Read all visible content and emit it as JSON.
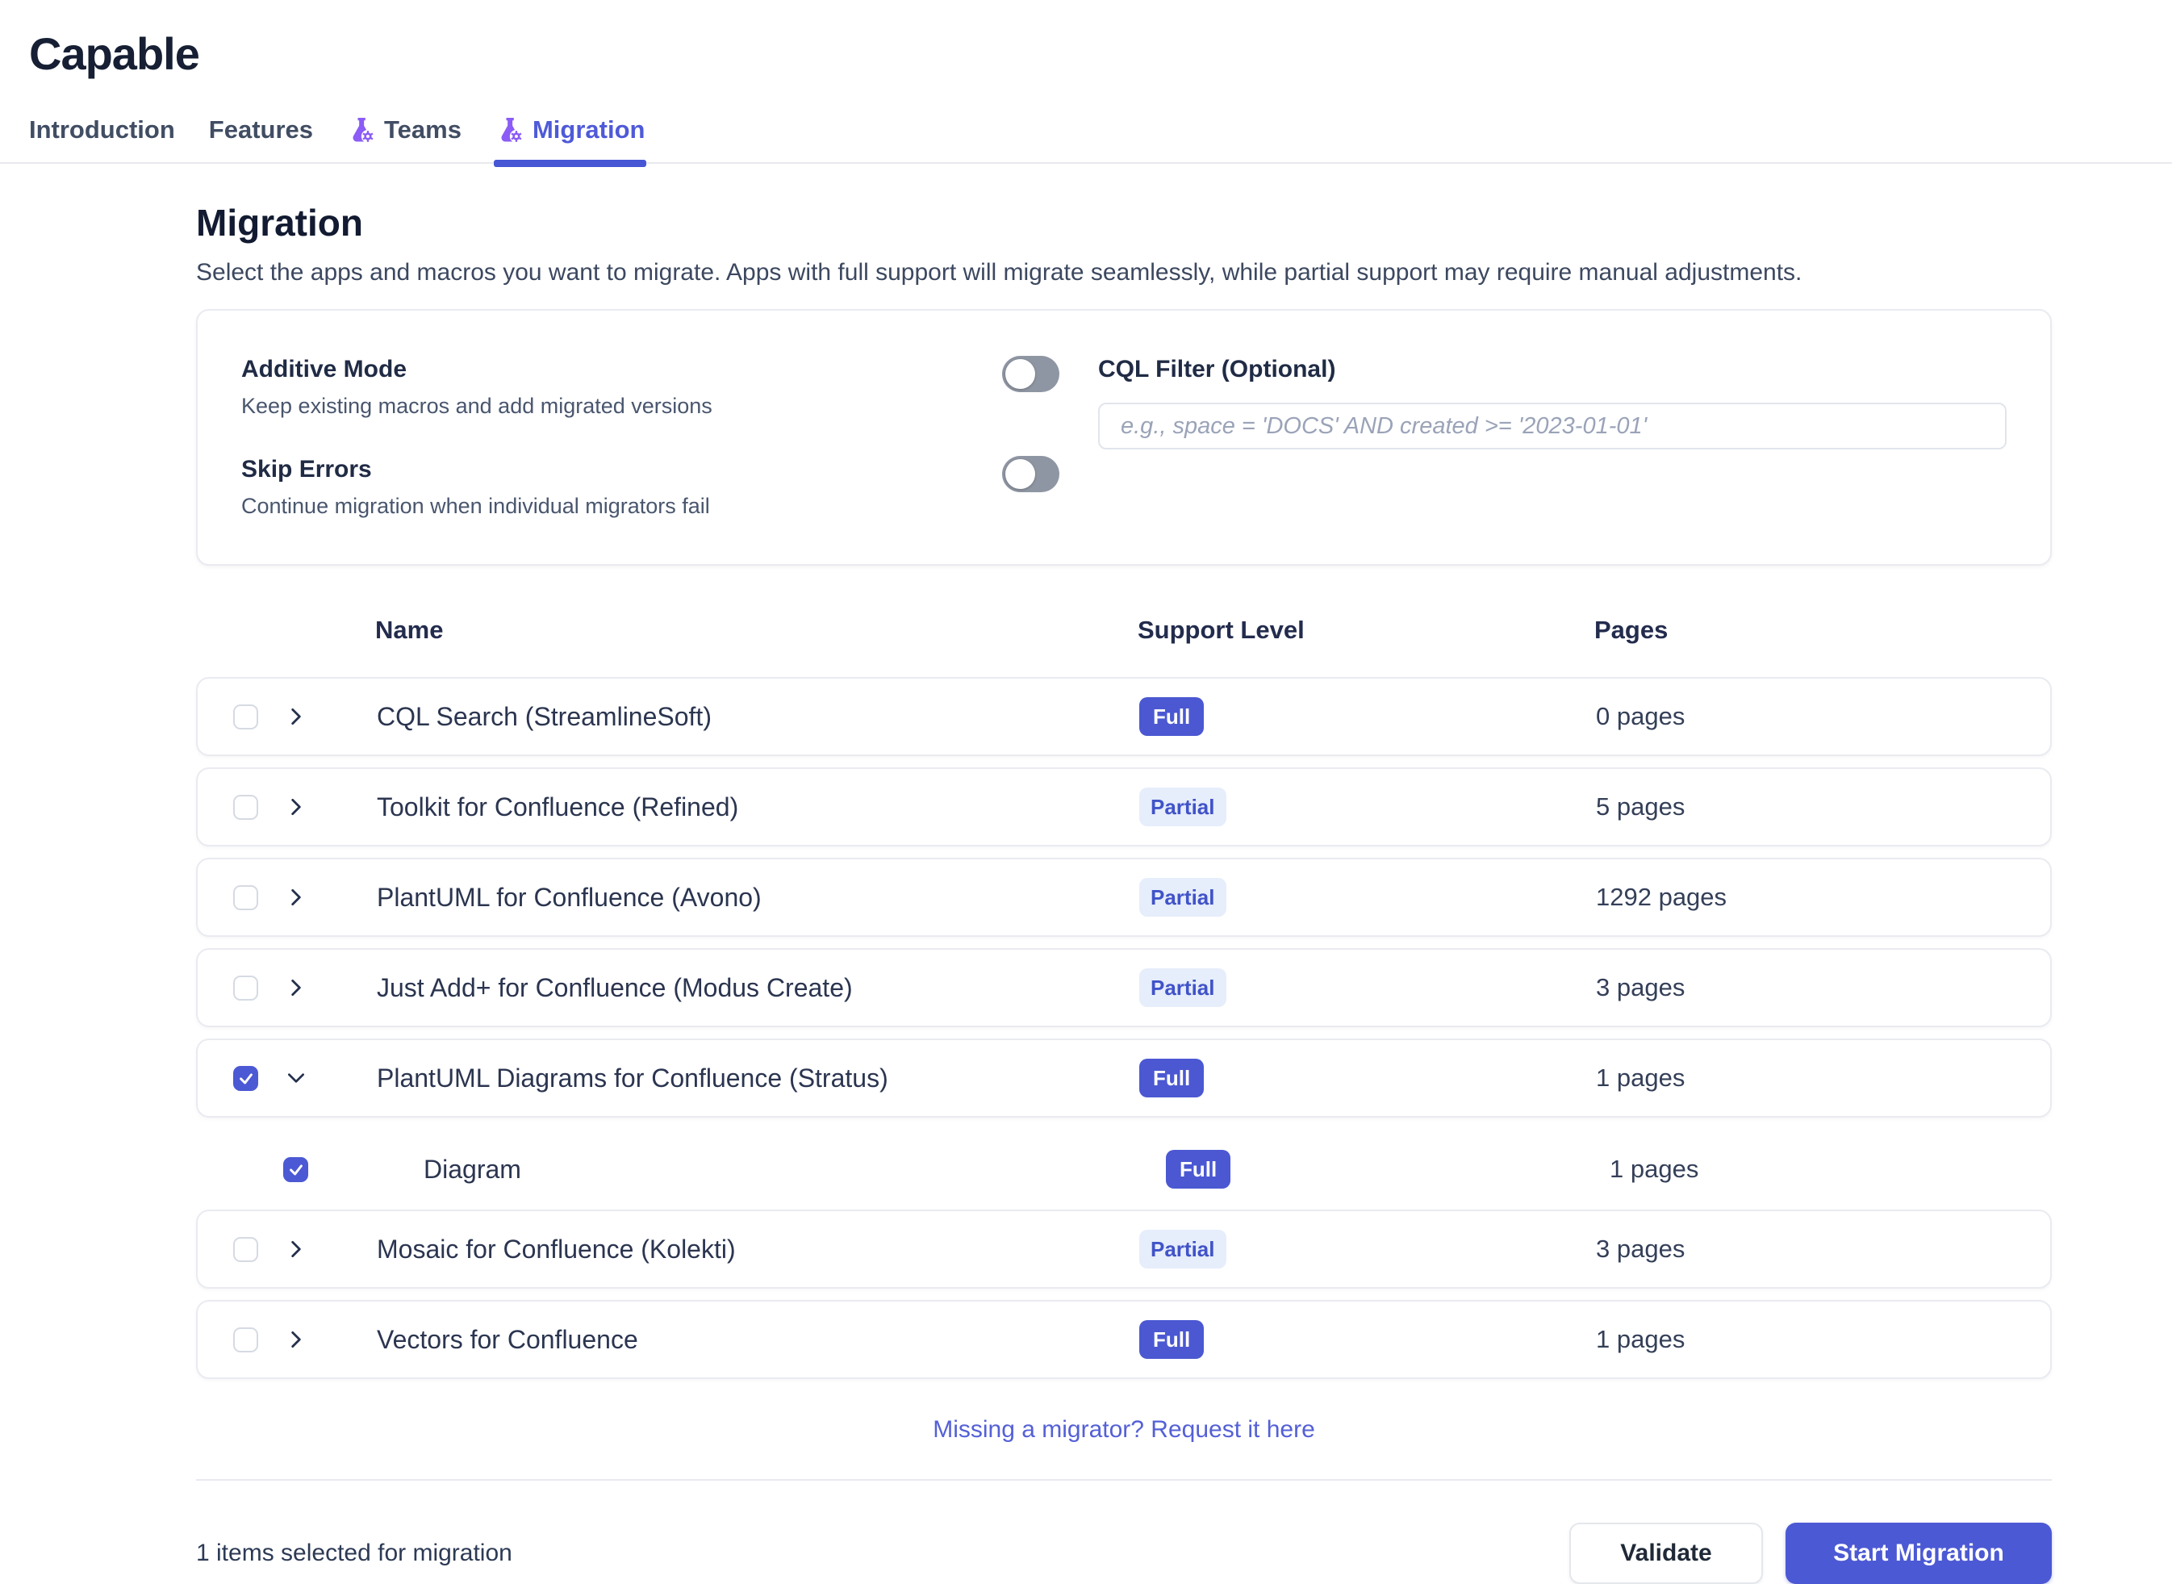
{
  "app": {
    "title": "Capable"
  },
  "tabs": [
    {
      "label": "Introduction",
      "active": false
    },
    {
      "label": "Features",
      "active": false
    },
    {
      "label": "Teams",
      "active": false,
      "icon": "flask-gear-icon"
    },
    {
      "label": "Migration",
      "active": true,
      "icon": "flask-gear-icon"
    }
  ],
  "page": {
    "title": "Migration",
    "description": "Select the apps and macros you want to migrate. Apps with full support will migrate seamlessly, while partial support may require manual adjustments."
  },
  "settings": {
    "additive_mode": {
      "label": "Additive Mode",
      "description": "Keep existing macros and add migrated versions",
      "enabled": false
    },
    "skip_errors": {
      "label": "Skip Errors",
      "description": "Continue migration when individual migrators fail",
      "enabled": false
    },
    "cql_filter": {
      "label": "CQL Filter (Optional)",
      "placeholder": "e.g., space = 'DOCS' AND created >= '2023-01-01'",
      "value": ""
    }
  },
  "table": {
    "headers": {
      "name": "Name",
      "support": "Support Level",
      "pages": "Pages"
    },
    "rows": [
      {
        "name": "CQL Search (StreamlineSoft)",
        "support": "Full",
        "pages": "0 pages",
        "checked": false,
        "expanded": false
      },
      {
        "name": "Toolkit for Confluence (Refined)",
        "support": "Partial",
        "pages": "5 pages",
        "checked": false,
        "expanded": false
      },
      {
        "name": "PlantUML for Confluence (Avono)",
        "support": "Partial",
        "pages": "1292 pages",
        "checked": false,
        "expanded": false
      },
      {
        "name": "Just Add+ for Confluence (Modus Create)",
        "support": "Partial",
        "pages": "3 pages",
        "checked": false,
        "expanded": false
      },
      {
        "name": "PlantUML Diagrams for Confluence (Stratus)",
        "support": "Full",
        "pages": "1 pages",
        "checked": true,
        "expanded": true,
        "children": [
          {
            "name": "Diagram",
            "support": "Full",
            "pages": "1 pages",
            "checked": true
          }
        ]
      },
      {
        "name": "Mosaic for Confluence (Kolekti)",
        "support": "Partial",
        "pages": "3 pages",
        "checked": false,
        "expanded": false
      },
      {
        "name": "Vectors for Confluence",
        "support": "Full",
        "pages": "1 pages",
        "checked": false,
        "expanded": false
      }
    ]
  },
  "request_link": "Missing a migrator? Request it here",
  "footer": {
    "status": "1 items selected for migration",
    "validate_label": "Validate",
    "start_label": "Start Migration"
  },
  "colors": {
    "primary_indigo": "#4c59d4",
    "active_tab": "#4f5ad8",
    "link": "#5460d6",
    "badge_full_bg": "#4b58d2",
    "badge_partial_bg": "#e6edfb",
    "badge_partial_text": "#4053c8",
    "icon_purple": "#8b5cf6",
    "toggle_off": "#8f96a3",
    "border": "#e9ebf0"
  }
}
